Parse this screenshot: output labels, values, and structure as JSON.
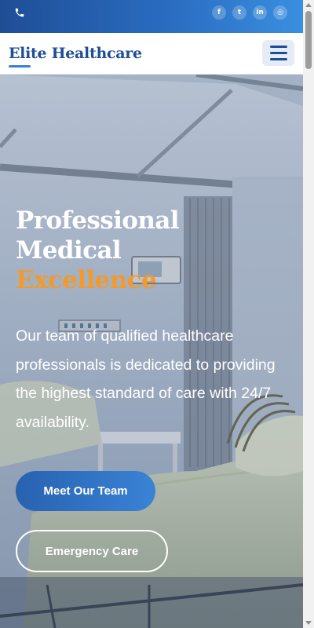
{
  "topbar": {
    "phone_icon": "phone-icon",
    "socials": [
      {
        "name": "facebook-icon",
        "glyph": "f"
      },
      {
        "name": "twitter-icon",
        "glyph": "t"
      },
      {
        "name": "linkedin-icon",
        "glyph": "in"
      },
      {
        "name": "instagram-icon",
        "glyph": "◎"
      }
    ]
  },
  "navbar": {
    "logo": "Elite Healthcare",
    "menu_icon": "hamburger-menu-icon"
  },
  "hero": {
    "title_line1": "Professional",
    "title_line2": "Medical",
    "title_accent": "Excellence",
    "description": "Our team of qualified healthcare professionals is dedicated to providing the highest standard of care with 24/7 availability.",
    "primary_button": "Meet Our Team",
    "secondary_button": "Emergency Care"
  },
  "colors": {
    "brand": "#1f4e96",
    "accent": "#f39a2b",
    "button_gradient_start": "#2862b0",
    "button_gradient_end": "#3a83d6"
  }
}
